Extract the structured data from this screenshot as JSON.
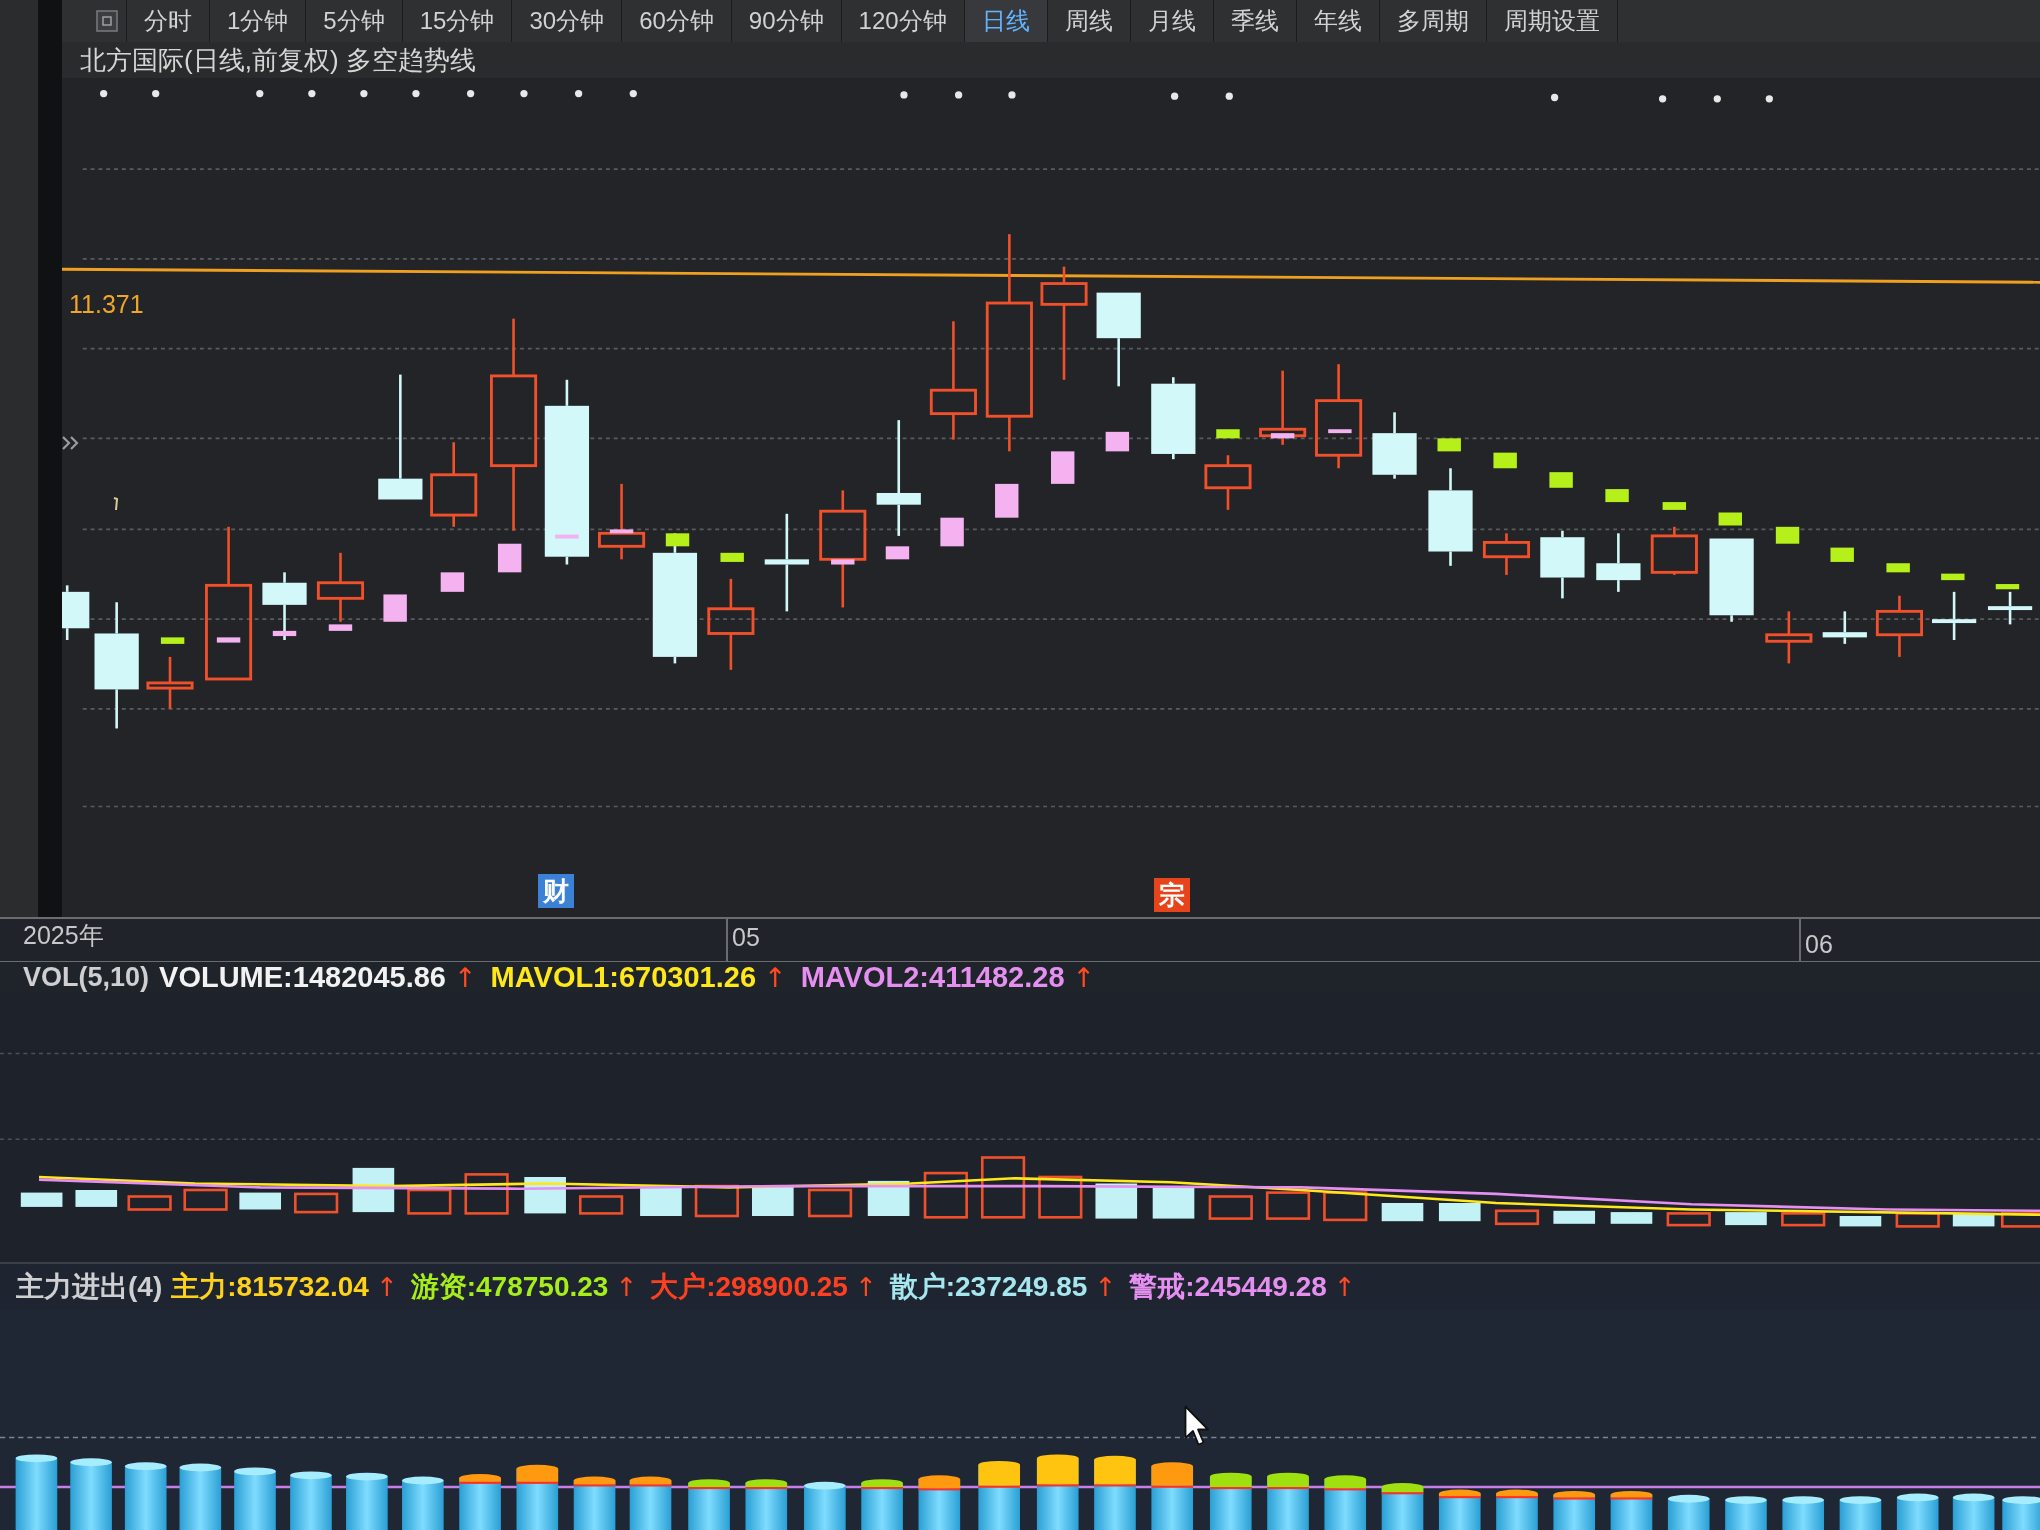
{
  "toolbar": {
    "tabs": [
      {
        "label": "分时",
        "selected": false
      },
      {
        "label": "1分钟",
        "selected": false
      },
      {
        "label": "5分钟",
        "selected": false
      },
      {
        "label": "15分钟",
        "selected": false
      },
      {
        "label": "30分钟",
        "selected": false
      },
      {
        "label": "60分钟",
        "selected": false
      },
      {
        "label": "90分钟",
        "selected": false
      },
      {
        "label": "120分钟",
        "selected": false
      },
      {
        "label": "日线",
        "selected": true
      },
      {
        "label": "周线",
        "selected": false
      },
      {
        "label": "月线",
        "selected": false
      },
      {
        "label": "季线",
        "selected": false
      },
      {
        "label": "年线",
        "selected": false
      },
      {
        "label": "多周期",
        "selected": false
      },
      {
        "label": "周期设置",
        "selected": false
      }
    ]
  },
  "chart_title": "北方国际(日线,前复权) 多空趋势线",
  "price_level": {
    "label": "11.371"
  },
  "event_markers": [
    {
      "label": "财",
      "color": "#3b82d6"
    },
    {
      "label": "宗",
      "color": "#e8441c"
    }
  ],
  "time_axis": {
    "labels": [
      "2025年",
      "05",
      "06"
    ]
  },
  "volume_indicator": {
    "name": "VOL(5,10)",
    "values": [
      {
        "text": "VOLUME:1482045.86",
        "color": "#f2f2f2",
        "trend": "↑"
      },
      {
        "text": "MAVOL1:670301.26",
        "color": "#ffe81a",
        "trend": "↑"
      },
      {
        "text": "MAVOL2:411482.28",
        "color": "#e58ff0",
        "trend": "↑"
      }
    ]
  },
  "capital_flow_indicator": {
    "name": "主力进出(4)",
    "values": [
      {
        "text": "主力:815732.04",
        "color": "#ffd21a",
        "trend": "↑"
      },
      {
        "text": "游资:478750.23",
        "color": "#a6ee1a",
        "trend": "↑"
      },
      {
        "text": "大户:298900.25",
        "color": "#ff4020",
        "trend": "↑"
      },
      {
        "text": "散户:237249.85",
        "color": "#a6e6ee",
        "trend": "↑"
      },
      {
        "text": "警戒:245449.28",
        "color": "#e58ff0",
        "trend": "↑"
      }
    ]
  }
}
